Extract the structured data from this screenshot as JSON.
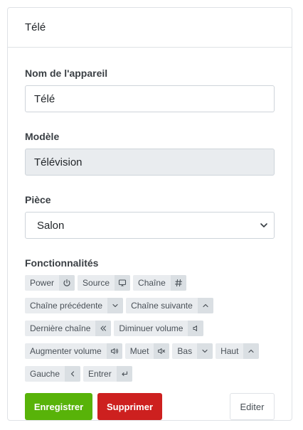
{
  "header": {
    "title": "Télé"
  },
  "form": {
    "name_label": "Nom de l'appareil",
    "name_value": "Télé",
    "model_label": "Modèle",
    "model_value": "Télévision",
    "room_label": "Pièce",
    "room_value": "Salon",
    "features_label": "Fonctionnalités"
  },
  "features": [
    {
      "label": "Power",
      "icon": "power-icon"
    },
    {
      "label": "Source",
      "icon": "cast-icon"
    },
    {
      "label": "Chaîne",
      "icon": "hash-icon"
    },
    {
      "label": "Chaîne précédente",
      "icon": "chevron-down-icon"
    },
    {
      "label": "Chaîne suivante",
      "icon": "chevron-up-icon"
    },
    {
      "label": "Dernière chaîne",
      "icon": "chevrons-left-icon"
    },
    {
      "label": "Diminuer volume",
      "icon": "volume-low-icon"
    },
    {
      "label": "Augmenter volume",
      "icon": "volume-high-icon"
    },
    {
      "label": "Muet",
      "icon": "volume-mute-icon"
    },
    {
      "label": "Bas",
      "icon": "chevron-down-icon"
    },
    {
      "label": "Haut",
      "icon": "chevron-up-icon"
    },
    {
      "label": "Gauche",
      "icon": "chevron-left-icon"
    },
    {
      "label": "Entrer",
      "icon": "enter-icon"
    }
  ],
  "actions": {
    "save_label": "Enregistrer",
    "delete_label": "Supprimer",
    "edit_label": "Editer"
  },
  "colors": {
    "save": "#58b309",
    "delete": "#cd201f"
  }
}
